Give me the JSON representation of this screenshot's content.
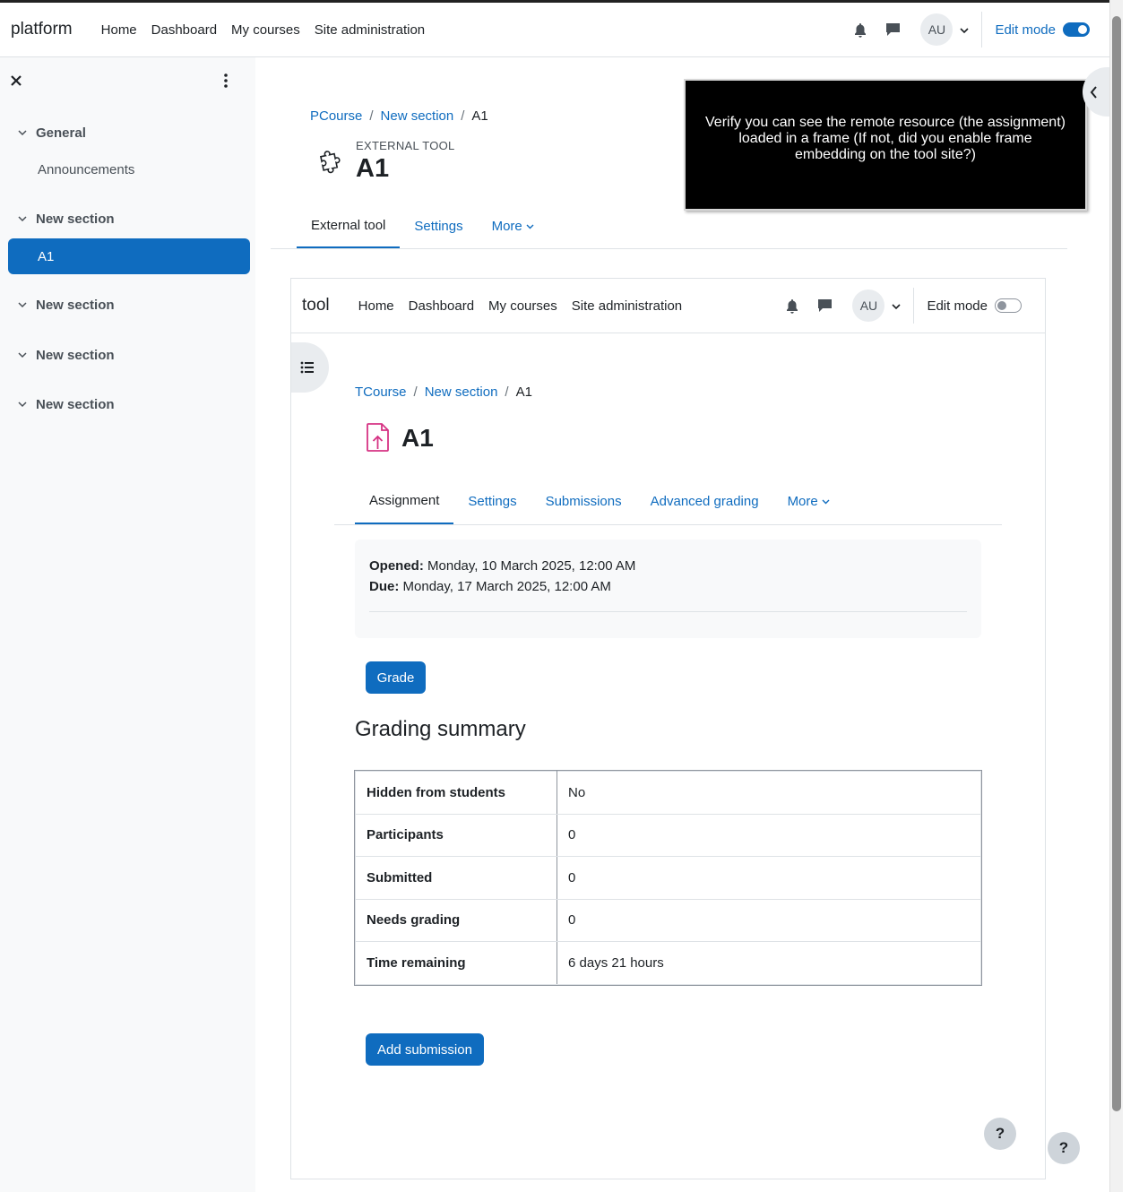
{
  "navbar": {
    "brand": "platform",
    "links": [
      "Home",
      "Dashboard",
      "My courses",
      "Site administration"
    ],
    "avatar": "AU",
    "edit_mode_label": "Edit mode",
    "edit_mode_on": true
  },
  "drawer": {
    "sections": [
      {
        "title": "General",
        "items": [
          "Announcements"
        ]
      },
      {
        "title": "New section",
        "items": [
          "A1"
        ]
      },
      {
        "title": "New section",
        "items": []
      },
      {
        "title": "New section",
        "items": []
      },
      {
        "title": "New section",
        "items": []
      }
    ],
    "active_item": "A1"
  },
  "page": {
    "breadcrumb": [
      "PCourse",
      "New section",
      "A1"
    ],
    "kicker": "EXTERNAL TOOL",
    "title": "A1",
    "tabs": [
      "External tool",
      "Settings",
      "More"
    ],
    "active_tab": "External tool"
  },
  "overlay": {
    "text": "Verify you can see the remote resource (the assignment) loaded in a frame (If not, did you enable frame embedding on the tool site?)"
  },
  "frame": {
    "brand": "tool",
    "links": [
      "Home",
      "Dashboard",
      "My courses",
      "Site administration"
    ],
    "avatar": "AU",
    "edit_mode_label": "Edit mode",
    "edit_mode_on": false,
    "breadcrumb": [
      "TCourse",
      "New section",
      "A1"
    ],
    "title": "A1",
    "tabs": [
      "Assignment",
      "Settings",
      "Submissions",
      "Advanced grading",
      "More"
    ],
    "active_tab": "Assignment",
    "dates": {
      "opened_label": "Opened:",
      "opened_value": "Monday, 10 March 2025, 12:00 AM",
      "due_label": "Due:",
      "due_value": "Monday, 17 March 2025, 12:00 AM"
    },
    "grade_button": "Grade",
    "summary_heading": "Grading summary",
    "summary_rows": [
      {
        "key": "Hidden from students",
        "value": "No"
      },
      {
        "key": "Participants",
        "value": "0"
      },
      {
        "key": "Submitted",
        "value": "0"
      },
      {
        "key": "Needs grading",
        "value": "0"
      },
      {
        "key": "Time remaining",
        "value": "6 days 21 hours"
      }
    ],
    "add_submission_button": "Add submission",
    "help": "?"
  },
  "help": "?",
  "colors": {
    "accent": "#0f6cbf",
    "drawer_bg": "#f8f9fa",
    "assign_icon": "#d63384"
  }
}
